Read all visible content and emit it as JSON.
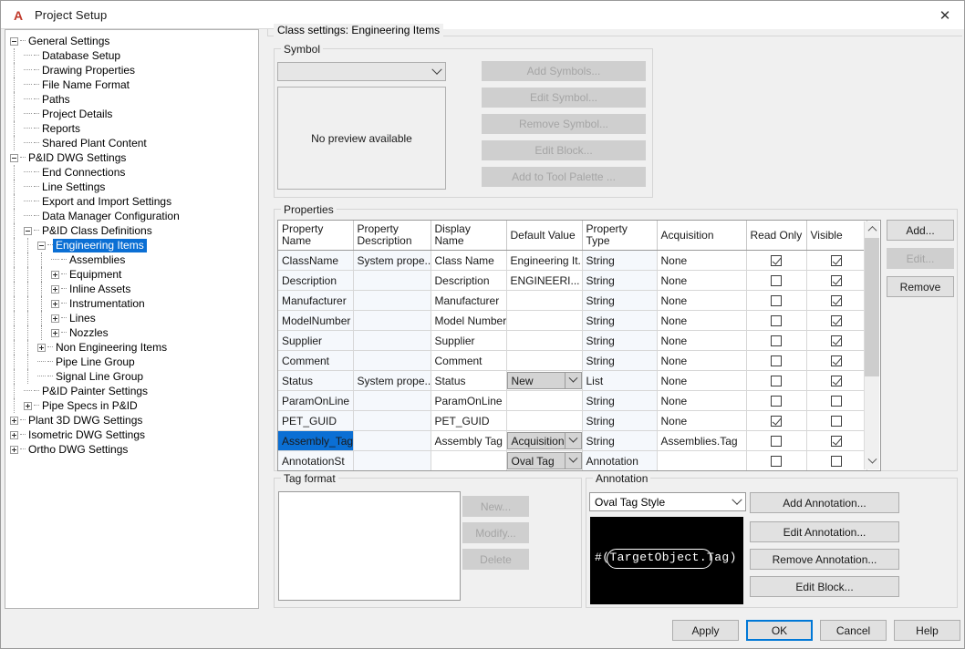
{
  "window": {
    "title": "Project Setup",
    "icon": "autodesk-a-icon",
    "close_label": "✕"
  },
  "tree": {
    "nodes": [
      {
        "label": "General Settings",
        "depth": 0,
        "toggle": "minus",
        "selected": false
      },
      {
        "label": "Database Setup",
        "depth": 1,
        "toggle": "leaf",
        "selected": false
      },
      {
        "label": "Drawing Properties",
        "depth": 1,
        "toggle": "leaf",
        "selected": false
      },
      {
        "label": "File Name Format",
        "depth": 1,
        "toggle": "leaf",
        "selected": false
      },
      {
        "label": "Paths",
        "depth": 1,
        "toggle": "leaf",
        "selected": false
      },
      {
        "label": "Project Details",
        "depth": 1,
        "toggle": "leaf",
        "selected": false
      },
      {
        "label": "Reports",
        "depth": 1,
        "toggle": "leaf",
        "selected": false
      },
      {
        "label": "Shared Plant Content",
        "depth": 1,
        "toggle": "leaf",
        "selected": false
      },
      {
        "label": "P&ID DWG Settings",
        "depth": 0,
        "toggle": "minus",
        "selected": false
      },
      {
        "label": "End Connections",
        "depth": 1,
        "toggle": "leaf",
        "selected": false
      },
      {
        "label": "Line Settings",
        "depth": 1,
        "toggle": "leaf",
        "selected": false
      },
      {
        "label": "Export and Import Settings",
        "depth": 1,
        "toggle": "leaf",
        "selected": false
      },
      {
        "label": "Data Manager Configuration",
        "depth": 1,
        "toggle": "leaf",
        "selected": false
      },
      {
        "label": "P&ID Class Definitions",
        "depth": 1,
        "toggle": "minus",
        "selected": false
      },
      {
        "label": "Engineering Items",
        "depth": 2,
        "toggle": "minus",
        "selected": true
      },
      {
        "label": "Assemblies",
        "depth": 3,
        "toggle": "leaf",
        "selected": false
      },
      {
        "label": "Equipment",
        "depth": 3,
        "toggle": "plus",
        "selected": false
      },
      {
        "label": "Inline Assets",
        "depth": 3,
        "toggle": "plus",
        "selected": false
      },
      {
        "label": "Instrumentation",
        "depth": 3,
        "toggle": "plus",
        "selected": false
      },
      {
        "label": "Lines",
        "depth": 3,
        "toggle": "plus",
        "selected": false
      },
      {
        "label": "Nozzles",
        "depth": 3,
        "toggle": "plus",
        "selected": false
      },
      {
        "label": "Non Engineering Items",
        "depth": 2,
        "toggle": "plus",
        "selected": false
      },
      {
        "label": "Pipe Line Group",
        "depth": 2,
        "toggle": "leaf",
        "selected": false
      },
      {
        "label": "Signal Line Group",
        "depth": 2,
        "toggle": "leaf",
        "selected": false
      },
      {
        "label": "P&ID Painter Settings",
        "depth": 1,
        "toggle": "leaf",
        "selected": false
      },
      {
        "label": "Pipe Specs in P&ID",
        "depth": 1,
        "toggle": "plus",
        "selected": false
      },
      {
        "label": "Plant 3D DWG Settings",
        "depth": 0,
        "toggle": "plus",
        "selected": false
      },
      {
        "label": "Isometric DWG Settings",
        "depth": 0,
        "toggle": "plus",
        "selected": false
      },
      {
        "label": "Ortho DWG Settings",
        "depth": 0,
        "toggle": "plus",
        "selected": false
      }
    ]
  },
  "class_settings": {
    "legend": "Class settings: Engineering Items"
  },
  "symbol": {
    "legend": "Symbol",
    "combo_value": "",
    "preview_text": "No preview available",
    "buttons": [
      {
        "label": "Add Symbols...",
        "enabled": false
      },
      {
        "label": "Edit Symbol...",
        "enabled": false
      },
      {
        "label": "Remove Symbol...",
        "enabled": false
      },
      {
        "label": "Edit Block...",
        "enabled": false
      },
      {
        "label": "Add to Tool Palette ...",
        "enabled": false
      }
    ]
  },
  "properties": {
    "legend": "Properties",
    "columns": [
      "Property Name",
      "Property Description",
      "Display Name",
      "Default Value",
      "Property Type",
      "Acquisition",
      "Read Only",
      "Visible"
    ],
    "rows": [
      {
        "name": "ClassName",
        "description": "System prope...",
        "display": "Class Name",
        "default": "Engineering It...",
        "default_combo": false,
        "type": "String",
        "acquisition": "None",
        "read_only": true,
        "visible": true,
        "selected": false
      },
      {
        "name": "Description",
        "description": "",
        "display": "Description",
        "default": "ENGINEERI...",
        "default_combo": false,
        "type": "String",
        "acquisition": "None",
        "read_only": false,
        "visible": true,
        "selected": false
      },
      {
        "name": "Manufacturer",
        "description": "",
        "display": "Manufacturer",
        "default": "",
        "default_combo": false,
        "type": "String",
        "acquisition": "None",
        "read_only": false,
        "visible": true,
        "selected": false
      },
      {
        "name": "ModelNumber",
        "description": "",
        "display": "Model Number",
        "default": "",
        "default_combo": false,
        "type": "String",
        "acquisition": "None",
        "read_only": false,
        "visible": true,
        "selected": false
      },
      {
        "name": "Supplier",
        "description": "",
        "display": "Supplier",
        "default": "",
        "default_combo": false,
        "type": "String",
        "acquisition": "None",
        "read_only": false,
        "visible": true,
        "selected": false
      },
      {
        "name": "Comment",
        "description": "",
        "display": "Comment",
        "default": "",
        "default_combo": false,
        "type": "String",
        "acquisition": "None",
        "read_only": false,
        "visible": true,
        "selected": false
      },
      {
        "name": "Status",
        "description": "System prope...",
        "display": "Status",
        "default": "New",
        "default_combo": true,
        "type": "List",
        "acquisition": "None",
        "read_only": false,
        "visible": true,
        "selected": false
      },
      {
        "name": "ParamOnLine",
        "description": "",
        "display": "ParamOnLine",
        "default": "",
        "default_combo": false,
        "type": "String",
        "acquisition": "None",
        "read_only": false,
        "visible": false,
        "selected": false
      },
      {
        "name": "PET_GUID",
        "description": "",
        "display": "PET_GUID",
        "default": "",
        "default_combo": false,
        "type": "String",
        "acquisition": "None",
        "read_only": true,
        "visible": false,
        "selected": false
      },
      {
        "name": "Assembly_Tag",
        "description": "",
        "display": "Assembly Tag",
        "default": "Acquisition",
        "default_combo": true,
        "type": "String",
        "acquisition": "Assemblies.Tag",
        "read_only": false,
        "visible": true,
        "selected": true
      },
      {
        "name": "AnnotationSt",
        "description": "",
        "display": "",
        "default": "Oval Tag",
        "default_combo": true,
        "type": "Annotation",
        "acquisition": "",
        "read_only": false,
        "visible": false,
        "selected": false
      }
    ],
    "buttons": [
      {
        "label": "Add...",
        "enabled": true
      },
      {
        "label": "Edit...",
        "enabled": false
      },
      {
        "label": "Remove",
        "enabled": true
      }
    ]
  },
  "tag_format": {
    "legend": "Tag format",
    "list_items": [],
    "buttons": [
      {
        "label": "New...",
        "enabled": false
      },
      {
        "label": "Modify...",
        "enabled": false
      },
      {
        "label": "Delete",
        "enabled": false
      }
    ]
  },
  "annotation": {
    "legend": "Annotation",
    "style_value": "Oval Tag Style",
    "preview_text": "#(TargetObject.Tag)",
    "buttons": [
      {
        "label": "Add Annotation...",
        "enabled": true
      },
      {
        "label": "Edit Annotation...",
        "enabled": true
      },
      {
        "label": "Remove Annotation...",
        "enabled": true
      },
      {
        "label": "Edit Block...",
        "enabled": true
      }
    ]
  },
  "footer": {
    "apply": "Apply",
    "ok": "OK",
    "cancel": "Cancel",
    "help": "Help"
  },
  "colors": {
    "selection_blue": "#0b6fd4",
    "focus_blue": "#0078d7",
    "dialog_bg": "#f0f0f0",
    "brand_red": "#c0392b"
  }
}
